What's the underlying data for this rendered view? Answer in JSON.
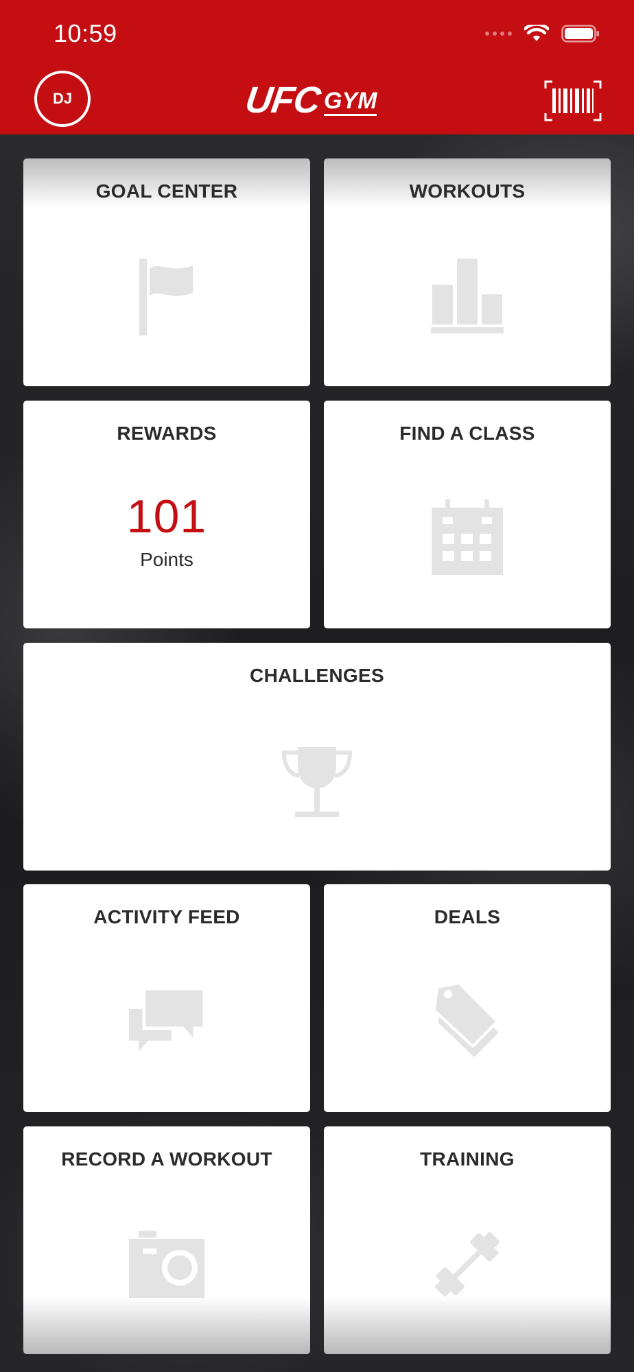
{
  "status_bar": {
    "time": "10:59"
  },
  "header": {
    "avatar_initials": "DJ",
    "logo_primary": "UFC",
    "logo_secondary": "GYM",
    "brand_color": "#c40e12"
  },
  "tiles": {
    "goal_center": {
      "title": "GOAL CENTER",
      "icon": "flag-icon"
    },
    "workouts": {
      "title": "WORKOUTS",
      "icon": "bar-chart-icon"
    },
    "rewards": {
      "title": "REWARDS",
      "value": "101",
      "unit": "Points"
    },
    "find_a_class": {
      "title": "FIND A CLASS",
      "icon": "calendar-icon"
    },
    "challenges": {
      "title": "CHALLENGES",
      "icon": "trophy-icon"
    },
    "activity_feed": {
      "title": "ACTIVITY FEED",
      "icon": "chat-bubbles-icon"
    },
    "deals": {
      "title": "DEALS",
      "icon": "tag-icon"
    },
    "record_a_workout": {
      "title": "RECORD A WORKOUT",
      "icon": "camera-icon"
    },
    "training": {
      "title": "TRAINING",
      "icon": "dumbbell-icon"
    }
  },
  "colors": {
    "icon_gray": "#e3e3e3",
    "accent": "#c40e12",
    "tile_text": "#2b2b2b"
  }
}
